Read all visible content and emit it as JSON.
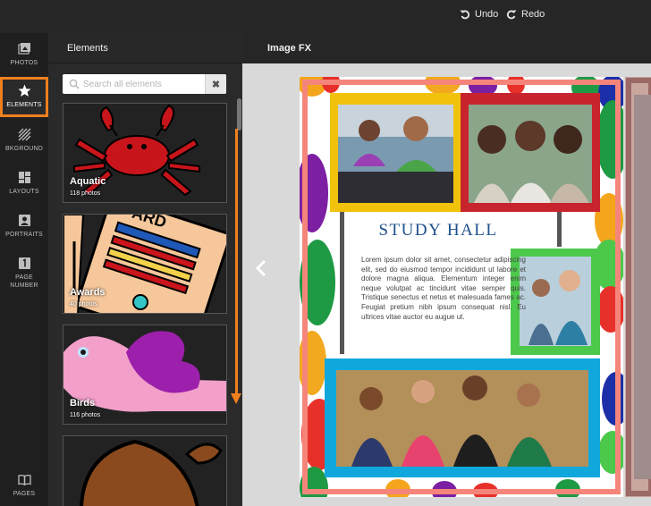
{
  "topbar": {
    "undo_label": "Undo",
    "redo_label": "Redo"
  },
  "rail": {
    "items": [
      {
        "label": "PHOTOS"
      },
      {
        "label": "ELEMENTS"
      },
      {
        "label": "BKGROUND"
      },
      {
        "label": "LAYOUTS"
      },
      {
        "label": "PORTRAITS"
      },
      {
        "label": "PAGE",
        "label2": "NUMBER"
      },
      {
        "label": "PAGES"
      }
    ],
    "active_color": "#f07f1e"
  },
  "panel": {
    "title": "Elements",
    "search_placeholder": "Search all elements",
    "clear_label": "✖",
    "categories": [
      {
        "name": "Aquatic",
        "count": "118 photos"
      },
      {
        "name": "Awards",
        "count": "40 photos"
      },
      {
        "name": "Birds",
        "count": "116 photos"
      }
    ]
  },
  "canvas": {
    "title": "Image FX",
    "page": {
      "heading": "STUDY HALL",
      "body": "Lorem ipsum dolor sit amet, consectetur adipiscing elit, sed do eiusmod tempor incididunt ut labore et dolore magna aliqua. Elementum integer enim neque volutpat ac tincidunt vitae semper quis. Tristique senectus et netus et malesuada fames ac. Feugiat pretium nibh ipsum consequat nisl. Eu ultrices vitae auctor eu augue ut."
    }
  },
  "colors": {
    "accent": "#f07f1e",
    "frame_yellow": "#f0c20c",
    "frame_red": "#c8242e",
    "frame_green": "#4cc84a",
    "frame_blue": "#10a8dc",
    "heading_blue": "#1d4f8a"
  }
}
